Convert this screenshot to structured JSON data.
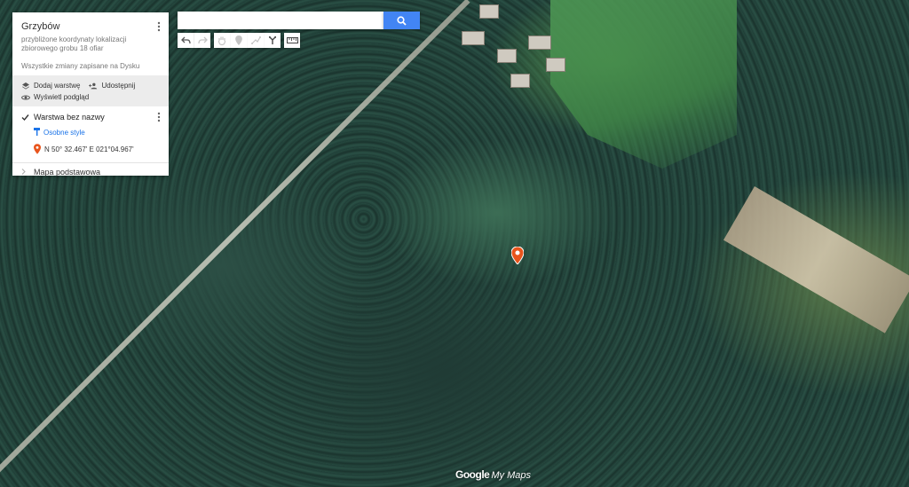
{
  "panel": {
    "title": "Grzybów",
    "description": "przybliżone koordynaty lokalizacji zbiorowego grobu 18 ofiar",
    "save_status": "Wszystkie zmiany zapisane na Dysku",
    "actions": {
      "add_layer": "Dodaj warstwę",
      "share": "Udostępnij",
      "preview": "Wyświetl podgląd"
    },
    "layer": {
      "name": "Warstwa bez nazwy",
      "checked": true,
      "styles_link": "Osobne style",
      "features": [
        {
          "name": "N 50° 32.467' E 021°04.967'",
          "icon": "map-pin-icon",
          "color": "#e8541c"
        }
      ]
    },
    "base_map_label": "Mapa podstawowa"
  },
  "search": {
    "value": "",
    "placeholder": "",
    "button_icon": "search-icon",
    "button_color": "#4285f4"
  },
  "toolbar": {
    "tools": [
      {
        "name": "undo-icon",
        "enabled": true
      },
      {
        "name": "redo-icon",
        "enabled": false
      },
      {
        "name": "hand-icon",
        "enabled": false
      },
      {
        "name": "add-marker-icon",
        "enabled": false
      },
      {
        "name": "draw-line-icon",
        "enabled": false
      },
      {
        "name": "directions-icon",
        "enabled": true
      },
      {
        "name": "ruler-icon",
        "enabled": true
      }
    ]
  },
  "map": {
    "marker_color": "#e8541c",
    "watermark_google": "Google",
    "watermark_mymaps": "My Maps"
  }
}
